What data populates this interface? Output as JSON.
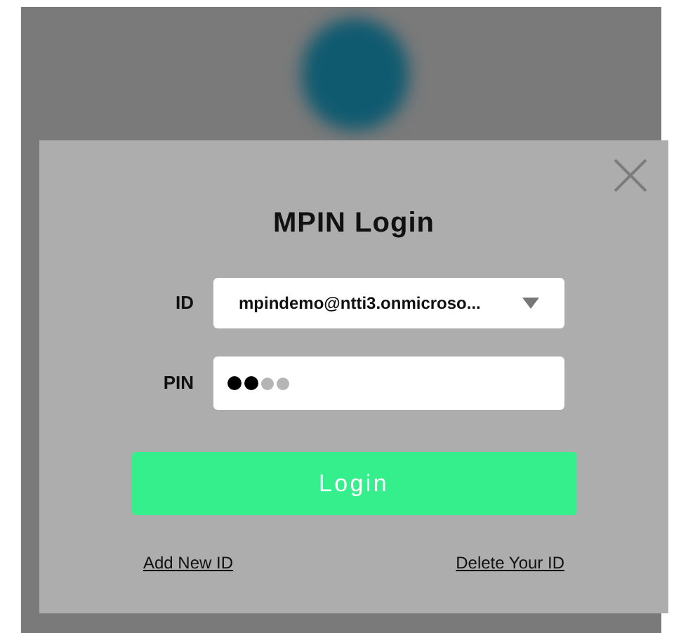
{
  "dialog": {
    "title": "MPIN Login",
    "id_field": {
      "label": "ID",
      "value": "mpindemo@ntti3.onmicroso..."
    },
    "pin_field": {
      "label": "PIN",
      "digits": [
        {
          "entered": true
        },
        {
          "entered": true
        },
        {
          "entered": false
        },
        {
          "entered": false
        }
      ]
    },
    "login_button": "Login",
    "links": [
      "Add New ID",
      "Delete Your ID"
    ]
  }
}
